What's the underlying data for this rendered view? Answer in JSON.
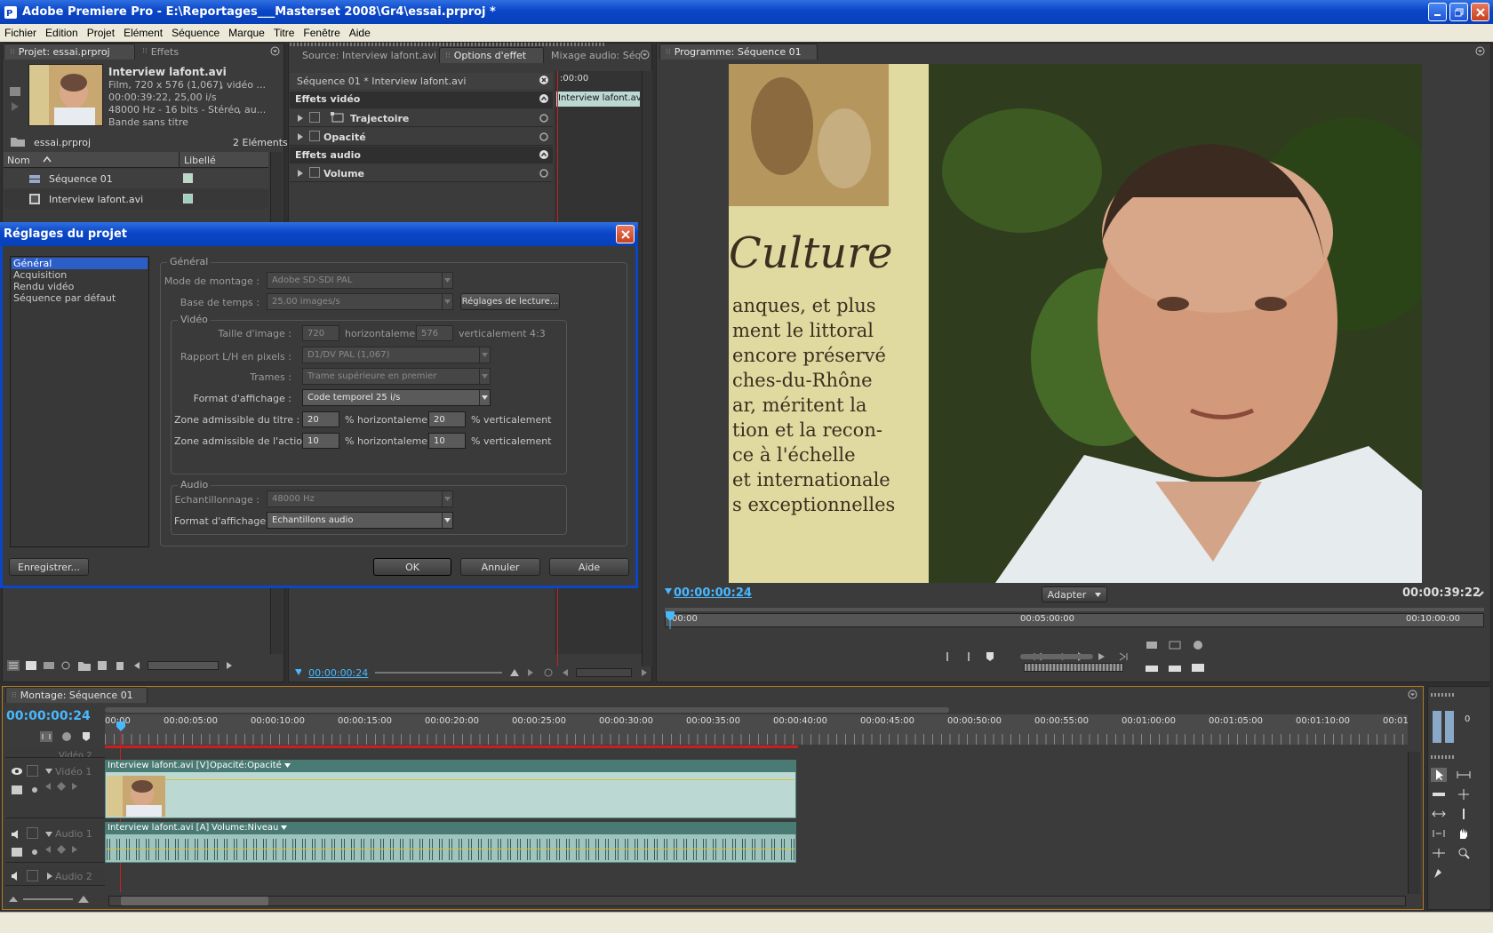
{
  "window": {
    "title": "Adobe Premiere Pro - E:\\Reportages___Masterset 2008\\Gr4\\essai.prproj *"
  },
  "menu": [
    "Fichier",
    "Edition",
    "Projet",
    "Elément",
    "Séquence",
    "Marque",
    "Titre",
    "Fenêtre",
    "Aide"
  ],
  "project_panel": {
    "tab_project": "Projet: essai.prproj",
    "tab_effects": "Effets",
    "clip_name": "Interview lafont.avi",
    "clip_info1": "Film, 720 x 576 (1,067)",
    "clip_info1b": ", vidéo ...",
    "clip_info2": "00:00:39:22, 25,00 i/s",
    "clip_info3": "48000 Hz - 16 bits - Stéréo",
    "clip_info3b": ", au...",
    "clip_info4": "Bande sans titre",
    "project_file": "essai.prproj",
    "items_count": "2 Eléments",
    "col_name": "Nom",
    "col_label": "Libellé",
    "items": [
      {
        "name": "Séquence 01"
      },
      {
        "name": "Interview lafont.avi"
      }
    ]
  },
  "effects_panel": {
    "tab_source": "Source: Interview lafont.avi",
    "tab_options": "Options d'effet",
    "tab_mix": "Mixage audio: Séq",
    "sequence_label": "Séquence 01 * Interview lafont.avi",
    "video_effects": "Effets vidéo",
    "audio_effects": "Effets audio",
    "fx_trajectoire": "Trajectoire",
    "fx_opacite": "Opacité",
    "fx_volume": "Volume",
    "mini_time": ":00:00",
    "mini_clip": "Interview lafont.avi",
    "timecode": "00:00:00:24"
  },
  "program_monitor": {
    "tab": "Programme: Séquence 01",
    "timecode_left": "00:00:00:24",
    "fit_label": "Adapter",
    "duration": "00:00:39:22",
    "ruler": [
      "00:00",
      "00:05:00:00",
      "00:10:00:00"
    ],
    "poster_lines": [
      "Culture",
      "anques, et plus",
      "ment le littoral",
      "encore préservé",
      "ches-du-Rhône",
      "ar, méritent la",
      "tion et la recon-",
      "ce à l'échelle",
      "et internationale",
      "s exceptionnelles"
    ]
  },
  "dialog": {
    "title": "Réglages du projet",
    "categories": [
      "Général",
      "Acquisition",
      "Rendu vidéo",
      "Séquence par défaut"
    ],
    "general_group": "Général",
    "mode_label": "Mode de montage :",
    "mode_value": "Adobe SD-SDI PAL",
    "timebase_label": "Base de temps :",
    "timebase_value": "25,00 images/s",
    "playback_btn": "Réglages de lecture...",
    "video_group": "Vidéo",
    "frame_size_label": "Taille d'image :",
    "frame_w": "720",
    "horiz": "horizontalement",
    "frame_h": "576",
    "vert_ratio": "verticalement 4:3",
    "par_label": "Rapport L/H en pixels :",
    "par_value": "D1/DV PAL (1,067)",
    "fields_label": "Trames :",
    "fields_value": "Trame supérieure en premier",
    "display_label": "Format d'affichage :",
    "display_value": "Code temporel 25 i/s",
    "title_safe_label": "Zone admissible du titre :",
    "title_safe_h": "20",
    "title_safe_v": "20",
    "action_safe_label": "Zone admissible de l'action :",
    "action_safe_h": "10",
    "action_safe_v": "10",
    "pct_h": "% horizontalement",
    "pct_v": "% verticalement",
    "audio_group": "Audio",
    "sample_label": "Echantillonnage :",
    "sample_value": "48000 Hz",
    "audio_display_label": "Format d'affichage :",
    "audio_display_value": "Echantillons audio",
    "save_btn": "Enregistrer...",
    "ok_btn": "OK",
    "cancel_btn": "Annuler",
    "help_btn": "Aide"
  },
  "timeline": {
    "tab": "Montage: Séquence 01",
    "timecode": "00:00:00:24",
    "ruler": [
      "00:00",
      "00:00:05:00",
      "00:00:10:00",
      "00:00:15:00",
      "00:00:20:00",
      "00:00:25:00",
      "00:00:30:00",
      "00:00:35:00",
      "00:00:40:00",
      "00:00:45:00",
      "00:00:50:00",
      "00:00:55:00",
      "00:01:00:00",
      "00:01:05:00",
      "00:01:10:00",
      "00:01:"
    ],
    "video2": "Vidéo 2",
    "video1": "Vidéo 1",
    "audio1": "Audio 1",
    "audio2": "Audio 2",
    "video_clip": "Interview lafont.avi [V]",
    "video_fx": "Opacité:Opacité",
    "audio_clip": "Interview lafont.avi [A]",
    "audio_fx": "Volume:Niveau",
    "meter_zero": "0"
  },
  "colors": {
    "accent": "#48b8ff",
    "clip": "#9fc7c2",
    "dialog_frame": "#0a46c8"
  }
}
